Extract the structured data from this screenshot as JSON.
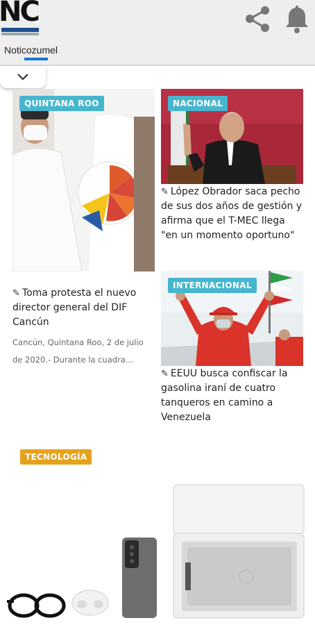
{
  "header": {
    "logo_text": "NC",
    "icons": [
      "share-icon",
      "bell-icon"
    ]
  },
  "tabs": [
    {
      "label": "Noticozumel"
    }
  ],
  "articles": [
    {
      "category": "QUINTANA ROO",
      "title": "Toma protesta el nuevo director general del DIF Cancún",
      "excerpt_line1": "Cancún, Quintana Roo, 2 de julio",
      "excerpt_line2": "de 2020.- Durante la cuadra..."
    },
    {
      "category": "NACIONAL",
      "title": "López Obrador saca pecho de sus dos años de gestión y afirma que el T-MEC llega \"en un momento oportuno\""
    },
    {
      "category": "INTERNACIONAL",
      "title": "EEUU busca confiscar la gasolina iraní de cuatro tanqueros en camino a Venezuela"
    },
    {
      "category": "TECNOLOGÍA"
    }
  ],
  "colors": {
    "badge_blue": "#46b6cf",
    "badge_gold": "#e5a21d",
    "tab_accent": "#1976d2"
  }
}
